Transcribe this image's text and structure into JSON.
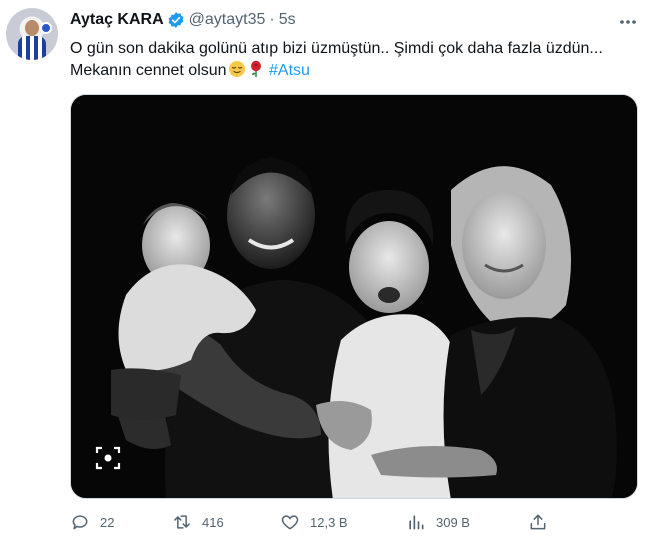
{
  "author": {
    "display_name": "Aytaç KARA",
    "handle": "@aytayt35",
    "separator": "·",
    "timestamp": "5s"
  },
  "tweet": {
    "text_line1": "O gün son dakika golünü atıp bizi üzmüştün.. Şimdi çok daha fazla üzdün...",
    "text_line2": "Mekanın cennet olsun",
    "emojis": [
      "relieved-face-emoji",
      "rose-emoji"
    ],
    "hashtag": "#Atsu"
  },
  "media": {
    "type": "black-and-white family photo",
    "overlay_icon": "scan-image-icon"
  },
  "actions": [
    {
      "icon": "reply-icon",
      "count": "22"
    },
    {
      "icon": "retweet-icon",
      "count": "416"
    },
    {
      "icon": "like-icon",
      "count": "12,3 B"
    },
    {
      "icon": "views-icon",
      "count": "309 B"
    },
    {
      "icon": "share-icon",
      "count": ""
    }
  ],
  "colors": {
    "accent": "#1d9bf0",
    "text": "#0f1419",
    "secondary": "#536471",
    "verified": "#1d9bf0"
  }
}
